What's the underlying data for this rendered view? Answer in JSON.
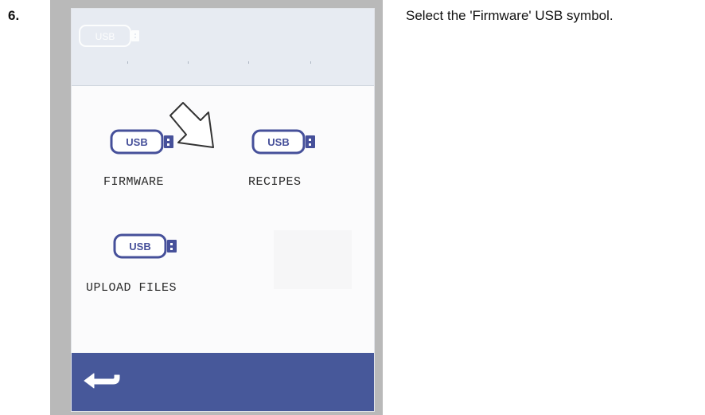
{
  "step": {
    "number": "6.",
    "instruction": "Select the 'Firmware' USB symbol."
  },
  "device": {
    "header": {
      "usb_icon_text": "USB"
    },
    "tiles": [
      {
        "usb_text": "USB",
        "label": "FIRMWARE"
      },
      {
        "usb_text": "USB",
        "label": "RECIPES"
      },
      {
        "usb_text": "USB",
        "label": "UPLOAD FILES"
      }
    ],
    "icons": {
      "usb": "usb-stick-icon",
      "pointer": "pointer-arrow-icon",
      "back": "back-arrow-icon"
    },
    "colors": {
      "accent": "#47589a",
      "usb_outline": "#46509a",
      "header_bg": "#e7ebf2",
      "frame": "#b9b9b9"
    }
  }
}
